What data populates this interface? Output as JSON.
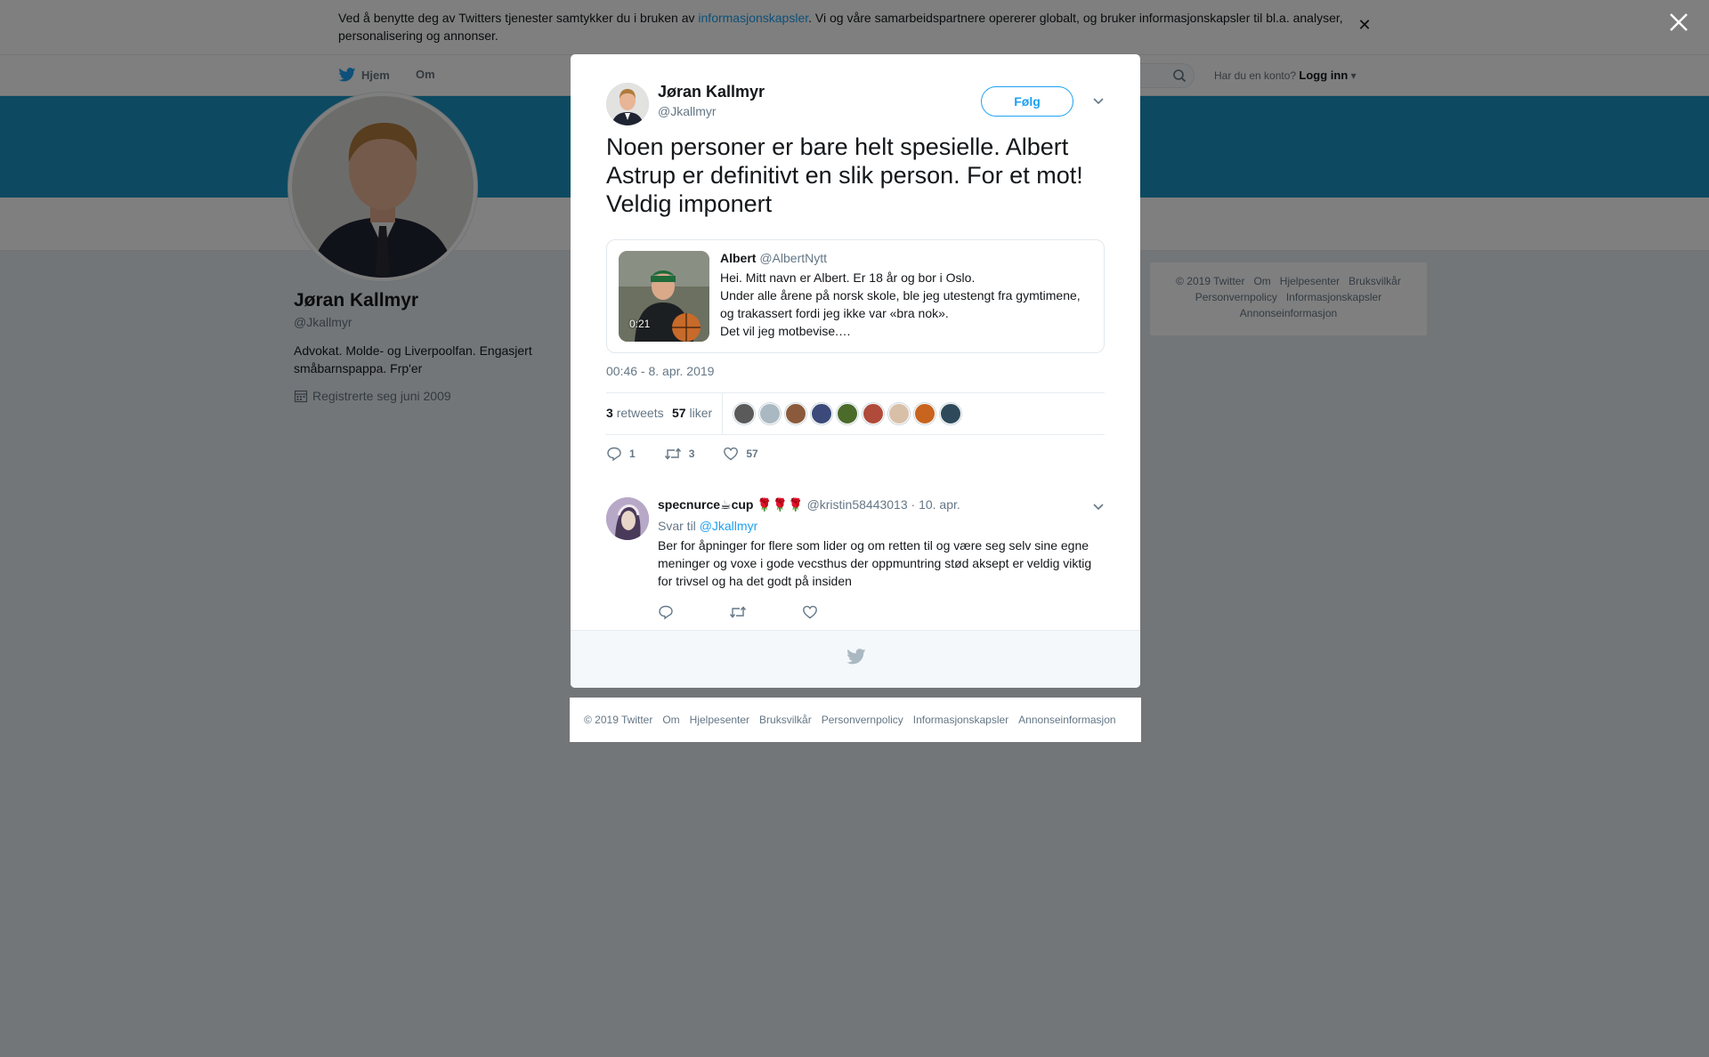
{
  "cookie": {
    "text_before": "Ved å benytte deg av Twitters tjenester samtykker du i bruken av ",
    "link": "informasjonskapsler",
    "text_after": ". Vi og våre samarbeidspartnere opererer globalt, og bruker informasjonskapsler til bl.a. analyser, personalisering og annonser."
  },
  "topnav": {
    "home": "Hjem",
    "about": "Om",
    "account_prompt": "Har du en konto?",
    "login": "Logg inn"
  },
  "profile": {
    "name": "Jøran Kallmyr",
    "handle": "@Jkallmyr",
    "bio": "Advokat. Molde- og Liverpoolfan. Engasjert småbarnspappa. Frp'er",
    "joined": "Registrerte seg juni 2009"
  },
  "side_footer": {
    "links": [
      "© 2019 Twitter",
      "Om",
      "Hjelpesenter",
      "Bruksvilkår",
      "Personvernpolicy",
      "Informasjonskapsler",
      "Annonseinformasjon"
    ]
  },
  "tweet": {
    "author_name": "Jøran Kallmyr",
    "author_handle": "@Jkallmyr",
    "follow_label": "Følg",
    "text": "Noen personer er bare helt spesielle. Albert Astrup er definitivt en slik person. For et mot! Veldig imponert",
    "timestamp": "00:46 - 8. apr. 2019",
    "retweets_count": "3",
    "retweets_label": "retweets",
    "likes_count": "57",
    "likes_label": "liker",
    "reply_count": "1",
    "retweet_action_count": "3",
    "like_action_count": "57",
    "liker_colors": [
      "#5a5a5a",
      "#aab8c2",
      "#8b5a3c",
      "#3b4a7a",
      "#4a6b2a",
      "#b04a3a",
      "#d8c0a8",
      "#c8641e",
      "#2e4a5a"
    ]
  },
  "quote": {
    "name": "Albert",
    "handle": "@AlbertNytt",
    "duration": "0:21",
    "lines": [
      "Hei. Mitt navn er Albert. Er 18 år og bor i Oslo.",
      "Under alle årene på norsk skole, ble jeg utestengt fra gymtimene, og trakassert fordi jeg ikke var «bra nok».",
      "Det vil jeg motbevise.…"
    ]
  },
  "reply": {
    "name": "specnurce☕cup 🌹🌹🌹",
    "handle": "@kristin58443013",
    "date": "· 10. apr.",
    "reply_to_label": "Svar til",
    "reply_to_handle": "@Jkallmyr",
    "text": "Ber for åpninger for flere som lider og om retten til og være seg selv sine egne meninger og voxe i gode vecsthus der oppmuntring stød aksept er veldig viktig for trivsel og ha det godt på insiden"
  },
  "bottom_footer": {
    "links": [
      "© 2019 Twitter",
      "Om",
      "Hjelpesenter",
      "Bruksvilkår",
      "Personvernpolicy",
      "Informasjonskapsler",
      "Annonseinformasjon"
    ]
  },
  "colors": {
    "accent": "#1da1f2",
    "banner": "#1b95c3",
    "overlay": "rgba(0,0,0,0.5)"
  }
}
